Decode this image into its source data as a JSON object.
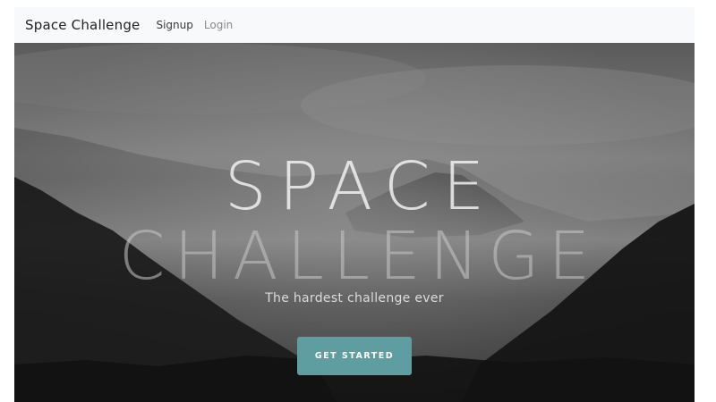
{
  "navbar": {
    "brand": "Space Challenge",
    "links": [
      {
        "label": "Signup"
      },
      {
        "label": "Login"
      }
    ]
  },
  "hero": {
    "title_line1": "SPACE",
    "title_line2": "CHALLENGE",
    "subtitle": "The hardest challenge ever",
    "cta_label": "GET STARTED",
    "background": "misty-mountains-photo-icon"
  },
  "colors": {
    "navbar_bg": "#f8f9fa",
    "cta_bg": "#5f9ea0"
  }
}
